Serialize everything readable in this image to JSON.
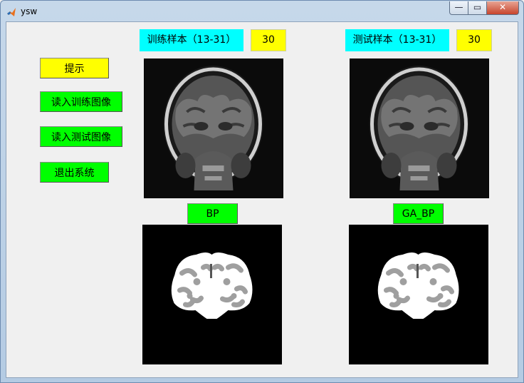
{
  "window": {
    "title": "ysw",
    "minimize_glyph": "—",
    "maximize_glyph": "▭",
    "close_glyph": "✕"
  },
  "buttons": {
    "hint": "提示",
    "load_train": "读入训练图像",
    "load_test": "读入测试图像",
    "exit": "退出系统"
  },
  "train": {
    "label": "训练样本（13-31）",
    "value": "30"
  },
  "test": {
    "label": "测试样本（13-31）",
    "value": "30"
  },
  "methods": {
    "bp": "BP",
    "ga_bp": "GA_BP"
  },
  "colors": {
    "yellow": "#ffff00",
    "green": "#00ff00",
    "cyan": "#00ffff"
  },
  "icons": {
    "app": "matlab-icon",
    "image_train": "mri-brain-image",
    "image_test": "mri-brain-image",
    "seg_bp": "brain-segmentation-image",
    "seg_ga": "brain-segmentation-image"
  }
}
